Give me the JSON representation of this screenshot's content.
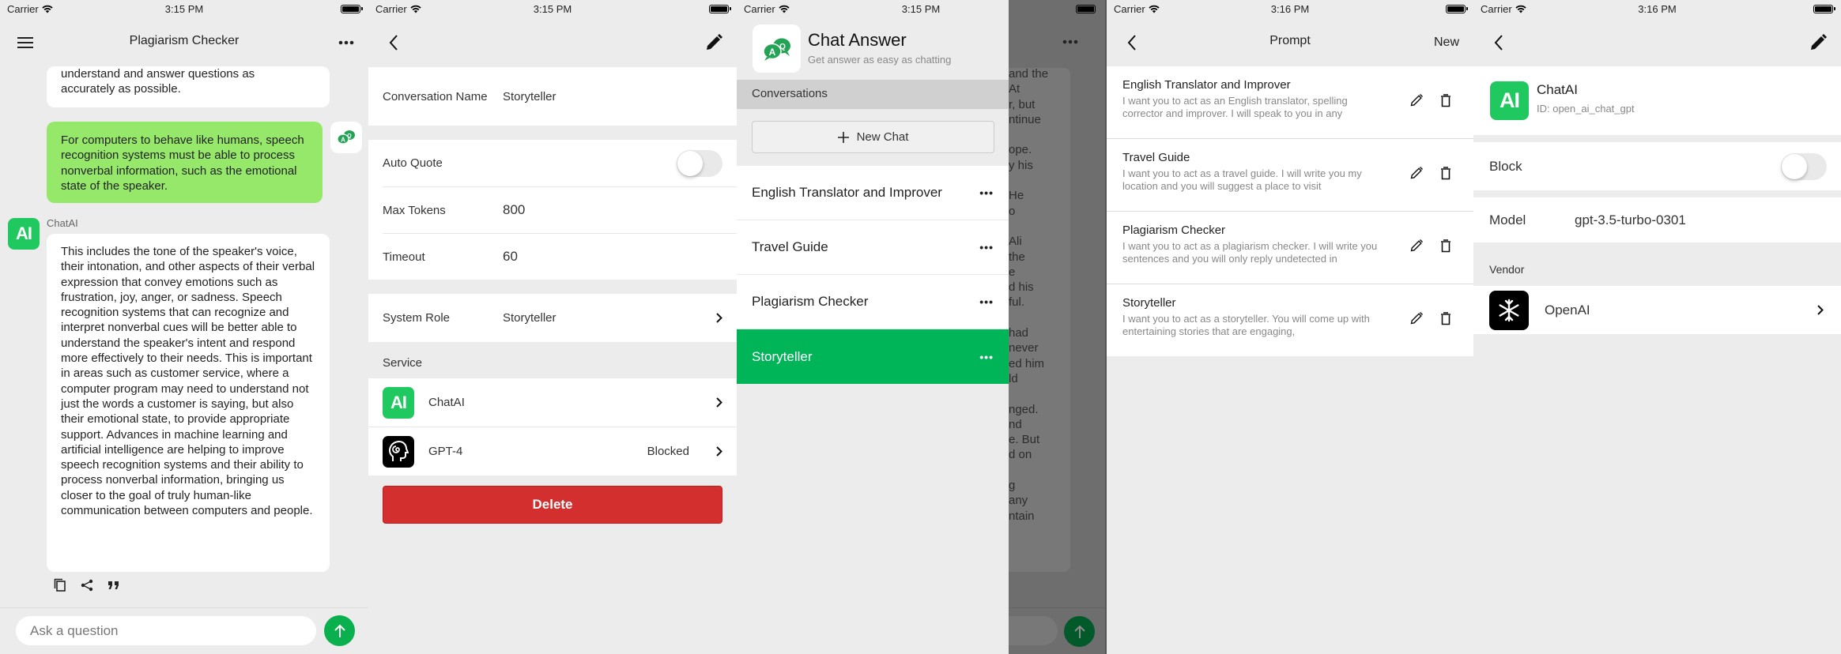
{
  "status_bars": [
    {
      "carrier": "Carrier",
      "time": "3:15 PM"
    },
    {
      "carrier": "Carrier",
      "time": "3:15 PM"
    },
    {
      "carrier": "Carrier",
      "time": "3:15 PM"
    },
    {
      "carrier": "Carrier",
      "time": "3:16 PM"
    },
    {
      "carrier": "Carrier",
      "time": "3:16 PM"
    }
  ],
  "chat": {
    "title": "Plagiarism Checker",
    "prev_ai_tail": "understand and answer questions as\naccurately as possible.",
    "user_message": "For computers to behave like humans, speech recognition systems must be able to process nonverbal information, such as the emotional state of the speaker.",
    "ai_sender": "ChatAI",
    "ai_logo_text": "AI",
    "ai_message": "This includes the tone of the speaker's voice, their intonation, and other aspects of their verbal expression that convey emotions such as frustration, joy, anger, or sadness. Speech recognition systems that can recognize and interpret nonverbal cues will be better able to understand the speaker's intent and respond more effectively to their needs. This is important in areas such as customer service, where a computer program may need to understand not just the words a customer is saying, but also their emotional state, to provide appropriate support. Advances in machine learning and artificial intelligence are helping to improve speech recognition systems and their ability to process nonverbal information, bringing us closer to the goal of truly human-like communication between computers and people.",
    "input_placeholder": "Ask a question"
  },
  "settings": {
    "conversation_name_label": "Conversation Name",
    "conversation_name": "Storyteller",
    "auto_quote_label": "Auto Quote",
    "auto_quote_on": false,
    "max_tokens_label": "Max Tokens",
    "max_tokens": "800",
    "timeout_label": "Timeout",
    "timeout": "60",
    "system_role_label": "System Role",
    "system_role": "Storyteller",
    "service_header": "Service",
    "services": [
      {
        "name": "ChatAI",
        "status": "",
        "icon": "ai-logo"
      },
      {
        "name": "GPT-4",
        "status": "Blocked",
        "icon": "head-spiral-icon"
      }
    ],
    "delete_label": "Delete"
  },
  "drawer": {
    "app_name": "Chat Answer",
    "tagline": "Get answer as easy as chatting",
    "conversations_header": "Conversations",
    "new_chat_label": "New Chat",
    "conversations": [
      {
        "name": "English Translator and Improver",
        "active": false
      },
      {
        "name": "Travel Guide",
        "active": false
      },
      {
        "name": "Plagiarism Checker",
        "active": false
      },
      {
        "name": "Storyteller",
        "active": true
      }
    ],
    "background_fragments": [
      "and the",
      "At",
      "r, but",
      "ntinue",
      "",
      "ope.",
      "y his",
      "",
      "He",
      "o",
      "",
      "Ali",
      "the",
      "e",
      "d his",
      "ful.",
      "",
      "had",
      "never",
      "ed him",
      "ld",
      "",
      "nged.",
      "nd",
      "e. But",
      "d on",
      "",
      "g",
      "any",
      "ntain"
    ]
  },
  "prompts": {
    "title": "Prompt",
    "new_label": "New",
    "items": [
      {
        "title": "English Translator and Improver",
        "desc": "I want you to act as an English translator, spelling corrector and improver. I will speak to you in any"
      },
      {
        "title": "Travel Guide",
        "desc": "I want you to act as a travel guide. I will write you my location and you will suggest a place to visit"
      },
      {
        "title": "Plagiarism Checker",
        "desc": "I want you to act as a plagiarism checker. I will write you sentences and you will only reply undetected in"
      },
      {
        "title": "Storyteller",
        "desc": "I want you to act as a storyteller. You will come up with entertaining stories that are engaging,"
      }
    ]
  },
  "service_detail": {
    "name": "ChatAI",
    "id_text": "ID: open_ai_chat_gpt",
    "block_label": "Block",
    "block_on": false,
    "model_label": "Model",
    "model": "gpt-3.5-turbo-0301",
    "vendor_header": "Vendor",
    "vendor": "OpenAI"
  },
  "colors": {
    "accent_green": "#00b558",
    "user_bubble": "#95e86a",
    "delete_red": "#d32f2f",
    "ai_logo_green": "#20c95f"
  }
}
